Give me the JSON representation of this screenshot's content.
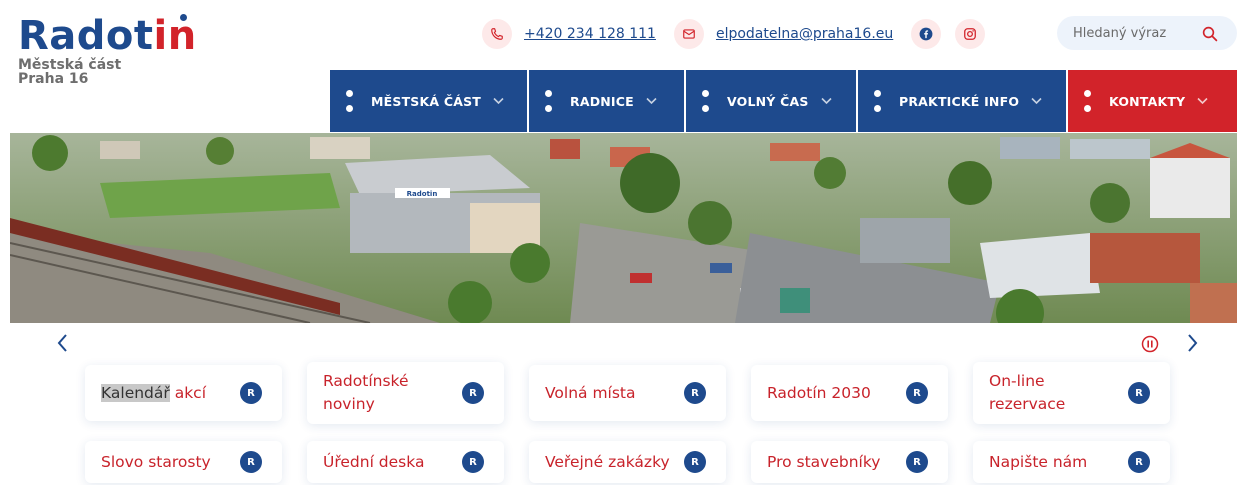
{
  "logo": {
    "word_main": "Radot",
    "word_accent": "in",
    "subtitle_line1": "Městská část",
    "subtitle_line2": "Praha 16"
  },
  "contact": {
    "phone": "+420 234 128 111",
    "email": "elpodatelna@praha16.eu"
  },
  "social": [
    "facebook-icon",
    "instagram-icon"
  ],
  "search": {
    "placeholder": "Hledaný výraz"
  },
  "nav": [
    {
      "label": "MĚSTSKÁ ČÁST"
    },
    {
      "label": "RADNICE"
    },
    {
      "label": "VOLNÝ ČAS"
    },
    {
      "label": "PRAKTICKÉ INFO"
    },
    {
      "label": "KONTAKTY"
    }
  ],
  "hero": {
    "building_sign": "Radotin"
  },
  "colors": {
    "primary": "#1e4a8d",
    "accent": "#d2232a"
  },
  "links": [
    {
      "label_a": "Kalendář",
      "label_b": " akcí",
      "badge": "R"
    },
    {
      "label": "Radotínské noviny",
      "badge": "R"
    },
    {
      "label": "Volná místa",
      "badge": "R"
    },
    {
      "label": "Radotín 2030",
      "badge": "R"
    },
    {
      "label": "On-line rezervace",
      "badge": "R"
    },
    {
      "label": "Slovo starosty",
      "badge": "R"
    },
    {
      "label": "Úřední deska",
      "badge": "R"
    },
    {
      "label": "Veřejné zakázky",
      "badge": "R"
    },
    {
      "label": "Pro stavebníky",
      "badge": "R"
    },
    {
      "label": "Napište nám",
      "badge": "R"
    }
  ]
}
